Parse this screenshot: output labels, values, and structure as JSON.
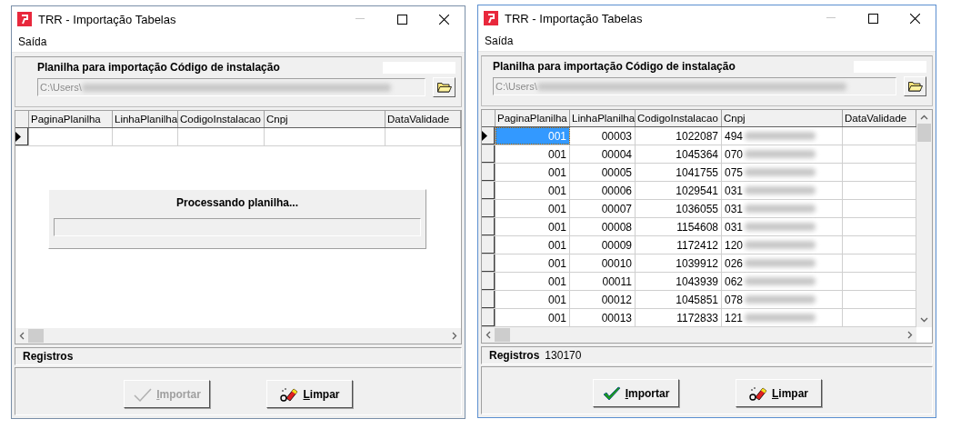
{
  "windows": [
    {
      "title": "TRR - Importação Tabelas",
      "menu": [
        "Saída"
      ],
      "file_label": "Planilha para importação Código de instalação",
      "path": "C:\\Users\\",
      "vscroll": false,
      "columns": [
        "PaginaPlanilha",
        "LinhaPlanilha",
        "CodigoInstalacao",
        "Cnpj",
        "DataValidade"
      ],
      "rows": [
        {
          "current": true
        }
      ],
      "dialog": {
        "message": "Processando planilha...",
        "level": 0
      },
      "status_label": "Registros",
      "buttons": [
        {
          "label": "Importar",
          "kind": "import",
          "disabled": true
        },
        {
          "label": "Limpar",
          "kind": "clear",
          "disabled": false
        }
      ]
    },
    {
      "title": "TRR - Importação Tabelas",
      "menu": [
        "Saída"
      ],
      "file_label": "Planilha para importação Código de instalação",
      "path": "C:\\Users\\",
      "vscroll": true,
      "columns": [
        "PaginaPlanilha",
        "LinhaPlanilha",
        "CodigoInstalacao",
        "Cnpj",
        "DataValidade"
      ],
      "rows": [
        {
          "current": true,
          "cells": [
            "001",
            "00003",
            "1022087",
            "494"
          ]
        },
        {
          "current": false,
          "cells": [
            "001",
            "00004",
            "1045364",
            "070"
          ]
        },
        {
          "current": false,
          "cells": [
            "001",
            "00005",
            "1041755",
            "075"
          ]
        },
        {
          "current": false,
          "cells": [
            "001",
            "00006",
            "1029541",
            "031"
          ]
        },
        {
          "current": false,
          "cells": [
            "001",
            "00007",
            "1036055",
            "031"
          ]
        },
        {
          "current": false,
          "cells": [
            "001",
            "00008",
            "1154608",
            "031"
          ]
        },
        {
          "current": false,
          "cells": [
            "001",
            "00009",
            "1172412",
            "120"
          ]
        },
        {
          "current": false,
          "cells": [
            "001",
            "00010",
            "1039912",
            "026"
          ]
        },
        {
          "current": false,
          "cells": [
            "001",
            "00011",
            "1043939",
            "062"
          ]
        },
        {
          "current": false,
          "cells": [
            "001",
            "00012",
            "1045851",
            "078"
          ]
        },
        {
          "current": false,
          "cells": [
            "001",
            "00013",
            "1172833",
            "121"
          ]
        }
      ],
      "status_label": "Registros",
      "status_value": "130170",
      "buttons": [
        {
          "label": "Importar",
          "kind": "import",
          "disabled": false
        },
        {
          "label": "Limpar",
          "kind": "clear",
          "disabled": false
        }
      ]
    }
  ]
}
